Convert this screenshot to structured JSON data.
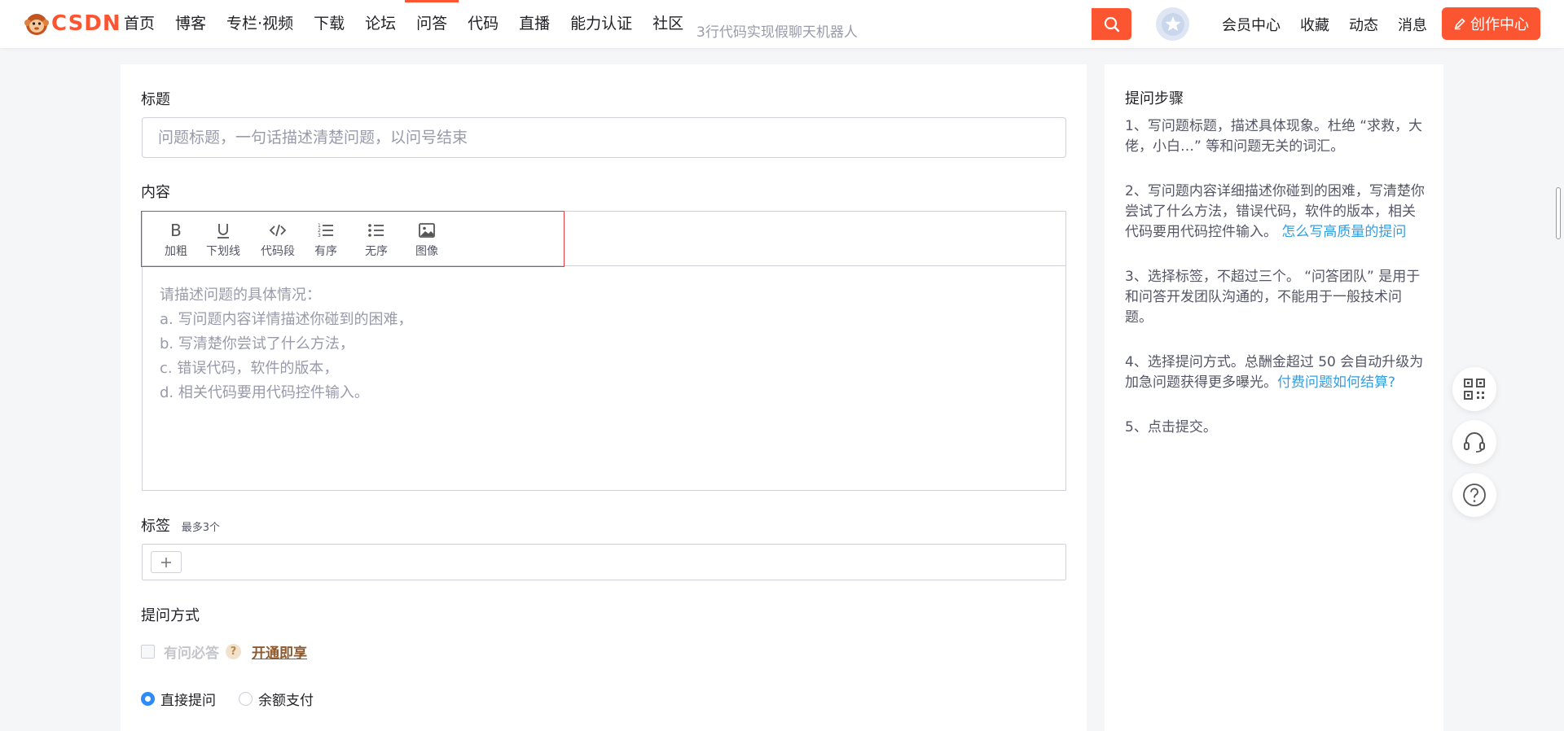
{
  "logo": {
    "text": "CSDN"
  },
  "nav": {
    "items": [
      "首页",
      "博客",
      "专栏·视频",
      "下载",
      "论坛",
      "问答",
      "代码",
      "直播",
      "能力认证",
      "社区"
    ],
    "active_index": 5
  },
  "search": {
    "placeholder": "3行代码实现假聊天机器人"
  },
  "header_links": [
    "会员中心",
    "收藏",
    "动态",
    "消息"
  ],
  "create_button": "创作中心",
  "form": {
    "title_label": "标题",
    "title_placeholder": "问题标题，一句话描述清楚问题，以问号结束",
    "content_label": "内容",
    "toolbar": [
      {
        "label": "加粗",
        "icon": "bold-icon"
      },
      {
        "label": "下划线",
        "icon": "underline-icon"
      },
      {
        "label": "代码段",
        "icon": "code-icon"
      },
      {
        "label": "有序",
        "icon": "ordered-list-icon"
      },
      {
        "label": "无序",
        "icon": "unordered-list-icon"
      },
      {
        "label": "图像",
        "icon": "image-icon"
      }
    ],
    "content_placeholder": [
      "请描述问题的具体情况：",
      "a. 写问题内容详情描述你碰到的困难，",
      "b. 写清楚你尝试了什么方法，",
      "c. 错误代码，软件的版本，",
      "d. 相关代码要用代码控件输入。"
    ],
    "tags_label": "标签",
    "tags_hint": "最多3个",
    "ask_method_label": "提问方式",
    "must_answer": "有问必答",
    "help_mark": "?",
    "vip_link": "开通即享",
    "pay_options": [
      "直接提问",
      "余额支付"
    ],
    "pay_selected": 0
  },
  "side": {
    "title": "提问步骤",
    "steps": [
      {
        "text": "1、写问题标题，描述具体现象。杜绝 “求救，大佬，小白…” 等和问题无关的词汇。",
        "link": ""
      },
      {
        "text": "2、写问题内容详细描述你碰到的困难，写清楚你尝试了什么方法，错误代码，软件的版本，相关代码要用代码控件输入。 ",
        "link": "怎么写高质量的提问"
      },
      {
        "text": "3、选择标签，不超过三个。 “问答团队” 是用于和问答开发团队沟通的，不能用于一般技术问题。",
        "link": ""
      },
      {
        "text": "4、选择提问方式。总酬金超过 50 会自动升级为加急问题获得更多曝光。",
        "link": "付费问题如何结算?"
      },
      {
        "text": "5、点击提交。",
        "link": ""
      }
    ]
  },
  "float_tools": [
    "qrcode-icon",
    "headset-icon",
    "help-circle-icon"
  ],
  "colors": {
    "brand": "#fc5531",
    "link": "#349edf",
    "radio": "#2e8af5"
  }
}
